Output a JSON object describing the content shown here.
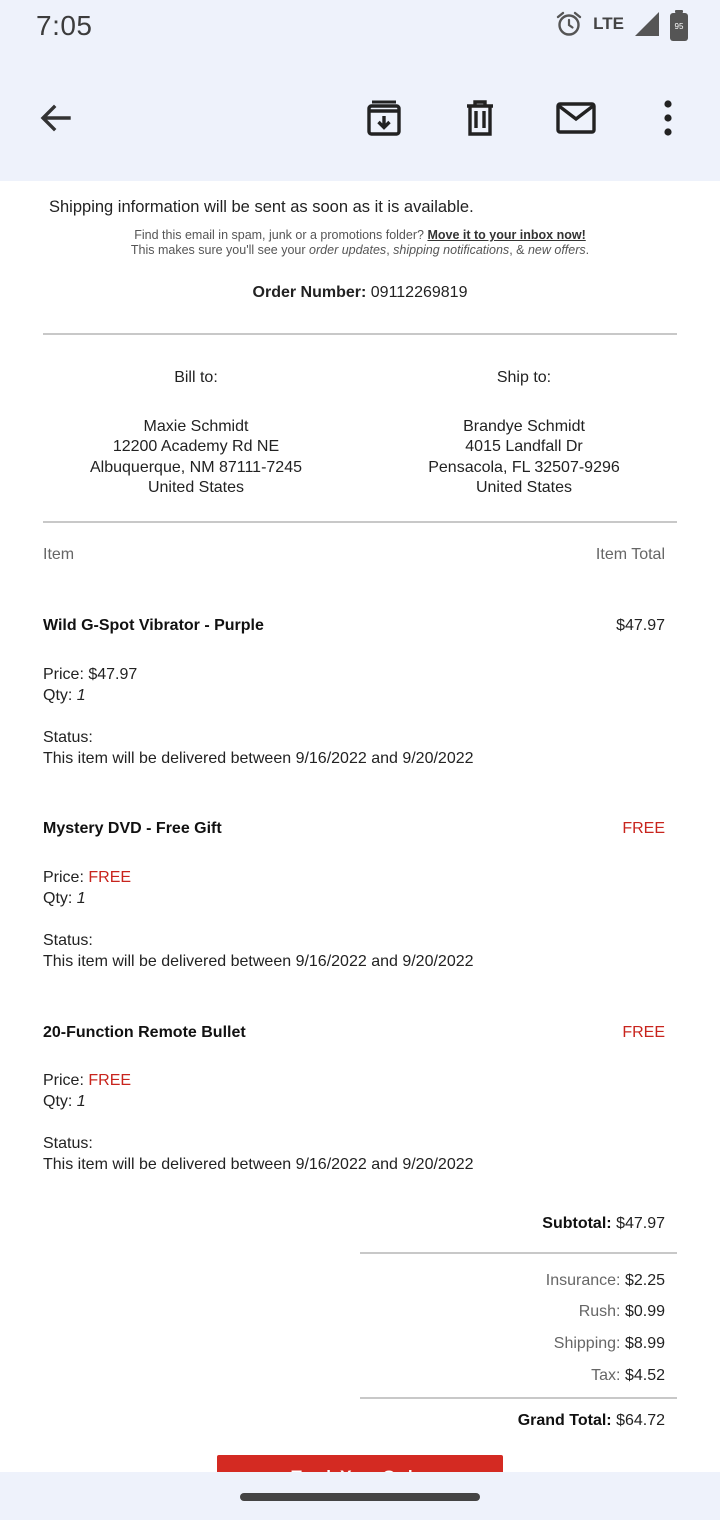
{
  "status_bar": {
    "time": "7:05",
    "network": "LTE",
    "battery": "95",
    "icons": [
      "alarm-icon",
      "signal-icon",
      "battery-icon"
    ]
  },
  "toolbar": {
    "icons": [
      "back-arrow-icon",
      "archive-icon",
      "delete-icon",
      "mark-unread-icon",
      "more-vert-icon"
    ]
  },
  "email": {
    "shipping_info": "Shipping information will be sent as soon as it is available.",
    "spam_note_prefix": "Find this email in spam, junk or a promotions folder?",
    "spam_note_link": "Move it to your inbox now!",
    "spam_note_line2_prefix": "This makes sure you'll see your",
    "spam_note_order_updates": "order updates",
    "spam_note_shipping": "shipping notifications",
    "spam_note_amp": ", &",
    "spam_note_new_offers": "new offers",
    "order_number_label": "Order Number:",
    "order_number": "09112269819",
    "bill_to": {
      "label": "Bill to:",
      "name": "Maxie Schmidt",
      "street": "12200 Academy Rd NE",
      "city": "Albuquerque, NM 87111-7245",
      "country": "United States"
    },
    "ship_to": {
      "label": "Ship to:",
      "name": "Brandye Schmidt",
      "street": "4015 Landfall Dr",
      "city": "Pensacola, FL 32507-9296",
      "country": "United States"
    },
    "items_header": {
      "item": "Item",
      "item_total": "Item Total"
    },
    "items": [
      {
        "name": "Wild G-Spot Vibrator - Purple",
        "total": "$47.97",
        "price_label": "Price:",
        "price": "$47.97",
        "qty_label": "Qty:",
        "qty": "1",
        "status_label": "Status:",
        "status": "This item will be delivered between 9/16/2022 and 9/20/2022"
      },
      {
        "name": "Mystery DVD - Free Gift",
        "total": "FREE",
        "price_label": "Price:",
        "price": "FREE",
        "qty_label": "Qty:",
        "qty": "1",
        "status_label": "Status:",
        "status": "This item will be delivered between 9/16/2022 and 9/20/2022"
      },
      {
        "name": "20-Function Remote Bullet",
        "total": "FREE",
        "price_label": "Price:",
        "price": "FREE",
        "qty_label": "Qty:",
        "qty": "1",
        "status_label": "Status:",
        "status": "This item will be delivered between 9/16/2022 and 9/20/2022"
      }
    ],
    "summary": {
      "subtotal_label": "Subtotal:",
      "subtotal": "$47.97",
      "insurance_label": "Insurance:",
      "insurance": "$2.25",
      "rush_label": "Rush:",
      "rush": "$0.99",
      "shipping_label": "Shipping:",
      "shipping": "$8.99",
      "tax_label": "Tax:",
      "tax": "$4.52",
      "grand_total_label": "Grand Total:",
      "grand_total": "$64.72"
    },
    "track_button": "Track Your Order"
  },
  "colors": {
    "accent_red": "#c8241d",
    "chrome_bg": "#eef2fb"
  }
}
